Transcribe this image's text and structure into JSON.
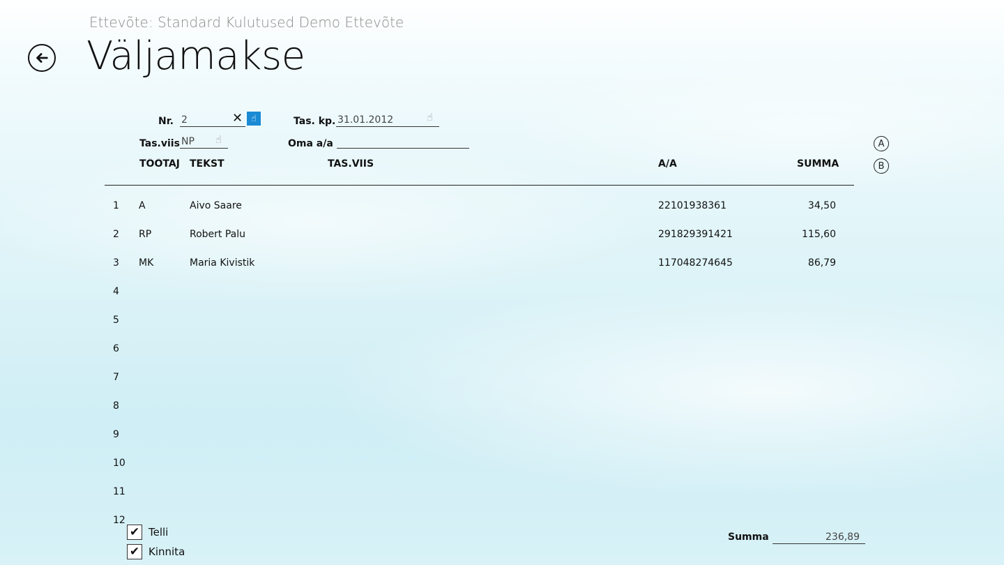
{
  "header": {
    "company": "Ettevõte: Standard Kulutused Demo Ettevõte",
    "title": "Väljamakse"
  },
  "form": {
    "nr_label": "Nr.",
    "nr_value": "2",
    "tas_kp_label": "Tas. kp.",
    "tas_kp_value": "31.01.2012",
    "tas_viis_label": "Tas.viis",
    "tas_viis_value": "NP",
    "oma_aa_label": "Oma a/a",
    "oma_aa_value": ""
  },
  "side_buttons": {
    "a": "A",
    "b": "B"
  },
  "table": {
    "columns": [
      "TÖÖTAJA",
      "TEKST",
      "TAS.VIIS",
      "A/A",
      "SUMMA"
    ],
    "rows": [
      {
        "num": "1",
        "code": "A",
        "text": "Aivo Saare",
        "aa": "22101938361",
        "sum": "34,50"
      },
      {
        "num": "2",
        "code": "RP",
        "text": "Robert Palu",
        "aa": "291829391421",
        "sum": "115,60"
      },
      {
        "num": "3",
        "code": "MK",
        "text": "Maria Kivistik",
        "aa": "117048274645",
        "sum": "86,79"
      },
      {
        "num": "4",
        "code": "",
        "text": "",
        "aa": "",
        "sum": ""
      },
      {
        "num": "5",
        "code": "",
        "text": "",
        "aa": "",
        "sum": ""
      },
      {
        "num": "6",
        "code": "",
        "text": "",
        "aa": "",
        "sum": ""
      },
      {
        "num": "7",
        "code": "",
        "text": "",
        "aa": "",
        "sum": ""
      },
      {
        "num": "8",
        "code": "",
        "text": "",
        "aa": "",
        "sum": ""
      },
      {
        "num": "9",
        "code": "",
        "text": "",
        "aa": "",
        "sum": ""
      },
      {
        "num": "10",
        "code": "",
        "text": "",
        "aa": "",
        "sum": ""
      },
      {
        "num": "11",
        "code": "",
        "text": "",
        "aa": "",
        "sum": ""
      },
      {
        "num": "12",
        "code": "",
        "text": "",
        "aa": "",
        "sum": ""
      }
    ]
  },
  "footer": {
    "telli_label": "Telli",
    "telli_checked": true,
    "kinnita_label": "Kinnita",
    "kinnita_checked": true,
    "summa_label": "Summa",
    "summa_value": "236,89"
  },
  "icons": {
    "back": "back-arrow-icon",
    "clear": "close-icon",
    "picker": "hand-pointer-icon",
    "check": "checkmark-icon"
  },
  "colors": {
    "accent": "#1a8ad4",
    "background_top": "#ffffff",
    "background_bottom": "#cfeef5"
  }
}
